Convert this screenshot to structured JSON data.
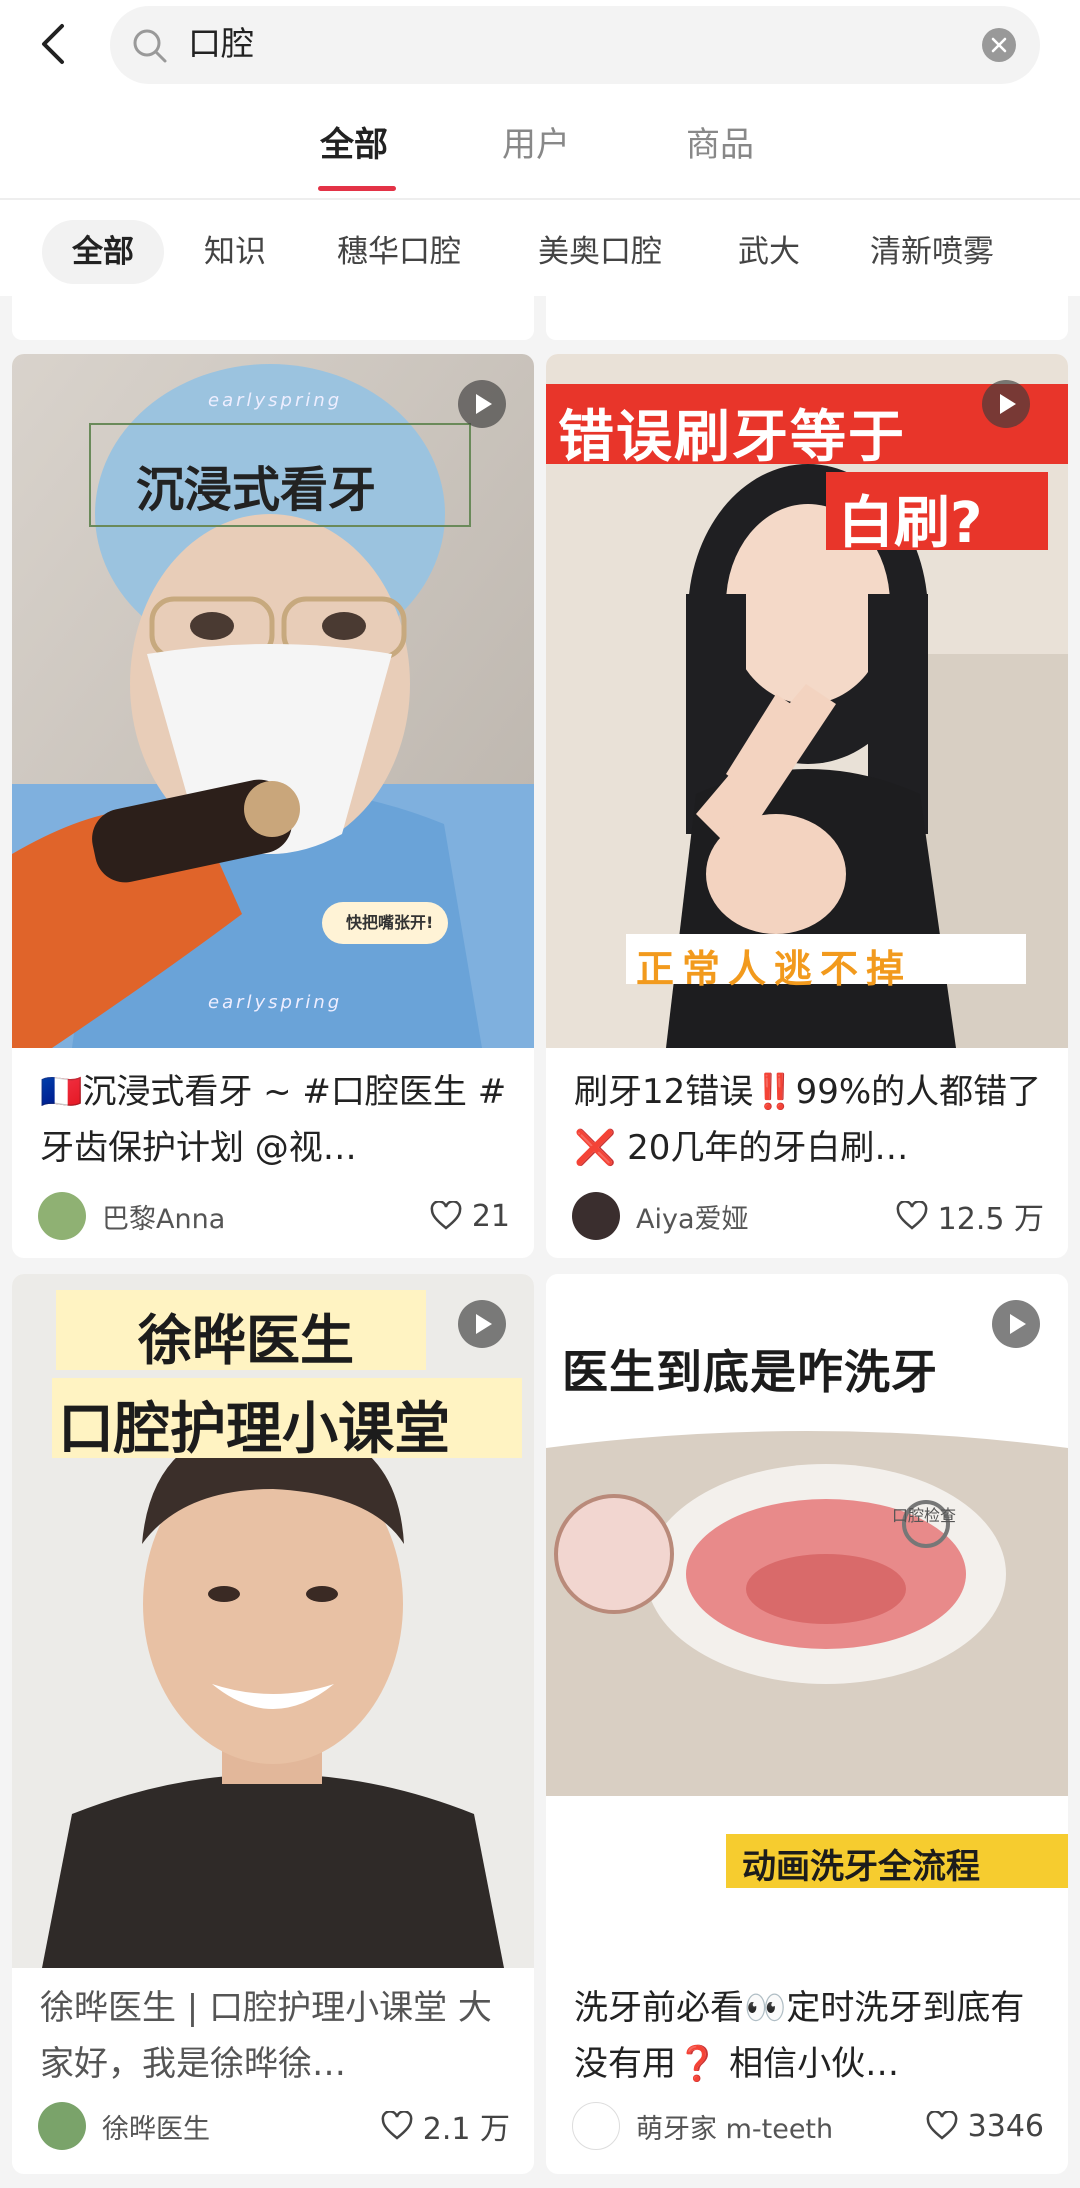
{
  "search": {
    "query": "口腔"
  },
  "tabs": [
    {
      "label": "全部",
      "active": true
    },
    {
      "label": "用户",
      "active": false
    },
    {
      "label": "商品",
      "active": false
    }
  ],
  "chips": [
    {
      "label": "全部",
      "active": true
    },
    {
      "label": "知识",
      "active": false
    },
    {
      "label": "穗华口腔",
      "active": false
    },
    {
      "label": "美奥口腔",
      "active": false
    },
    {
      "label": "武大",
      "active": false
    },
    {
      "label": "清新喷雾",
      "active": false
    }
  ],
  "colors": {
    "accent": "#e33246",
    "feed_background": "#f4f4f4"
  },
  "cards": [
    {
      "cover_texts": [
        "earlyspring",
        "沉浸式看牙",
        "快把嘴张开!",
        "earlyspring"
      ],
      "title": "🇫🇷沉浸式看牙 ~ #口腔医生 #牙齿保护计划 @视…",
      "author": "巴黎Anna",
      "likes": "21",
      "is_video": true
    },
    {
      "cover_texts": [
        "错误刷牙等于",
        "白刷?",
        "正常人逃不掉"
      ],
      "title": "刷牙12错误‼️99%的人都错了❌ 20几年的牙白刷…",
      "author": "Aiya爱娅",
      "likes": "12.5 万",
      "is_video": true
    },
    {
      "cover_texts": [
        "徐晔医生",
        "口腔护理小课堂"
      ],
      "title": "徐晔医生 | 口腔护理小课堂 大家好，我是徐晔徐…",
      "author": "徐晔医生",
      "likes": "2.1 万",
      "is_video": true
    },
    {
      "cover_texts": [
        "医生到底是咋洗牙",
        "口腔检查",
        "动画洗牙全流程"
      ],
      "title": "洗牙前必看👀定时洗牙到底有没有用❓ 相信小伙…",
      "author": "萌牙家 m-teeth",
      "likes": "3346",
      "is_video": true
    }
  ]
}
